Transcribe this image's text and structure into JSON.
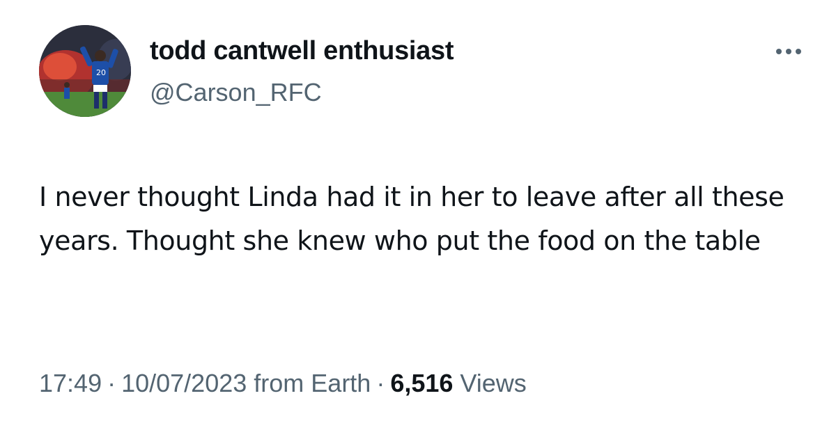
{
  "author": {
    "display_name": "todd cantwell enthusiast",
    "handle": "@Carson_RFC",
    "avatar_icon": "football-celebration-avatar"
  },
  "tweet": {
    "text": "I never thought Linda had it in her to leave after all these years. Thought she knew who put the food on the table"
  },
  "meta": {
    "time": "17:49",
    "separator": "·",
    "date": "10/07/2023",
    "source": "from Earth",
    "views_count": "6,516",
    "views_label": "Views"
  },
  "icons": {
    "more": "more-options-icon"
  },
  "colors": {
    "primary_text": "#0f1419",
    "secondary_text": "#536471",
    "background": "#ffffff"
  }
}
